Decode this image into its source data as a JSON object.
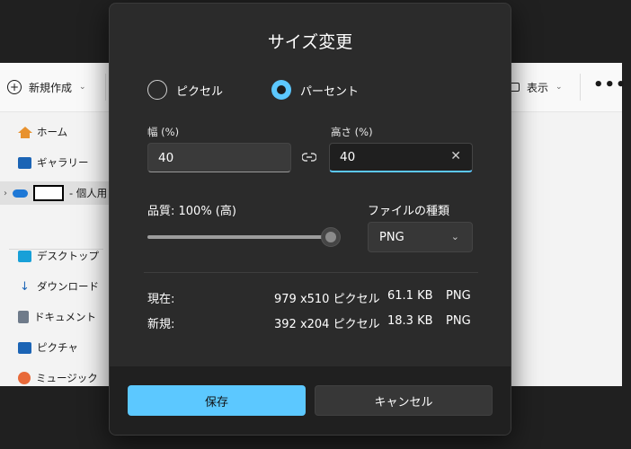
{
  "explorer": {
    "new_label": "新規作成",
    "view_label": "表示",
    "more_label": "•••",
    "sidebar": {
      "items": [
        {
          "label": "ホーム",
          "icon": "home-icon"
        },
        {
          "label": "ギャラリー",
          "icon": "gallery-icon"
        },
        {
          "label": "- 個人用",
          "icon": "onedrive-icon"
        },
        {
          "label": "デスクトップ",
          "icon": "desktop-icon"
        },
        {
          "label": "ダウンロード",
          "icon": "download-icon"
        },
        {
          "label": "ドキュメント",
          "icon": "documents-icon"
        },
        {
          "label": "ピクチャ",
          "icon": "pictures-icon"
        },
        {
          "label": "ミュージック",
          "icon": "music-icon"
        }
      ]
    }
  },
  "dialog": {
    "title": "サイズ変更",
    "mode": {
      "pixel_label": "ピクセル",
      "percent_label": "パーセント",
      "selected": "percent"
    },
    "width": {
      "label": "幅 (%)",
      "value": "40"
    },
    "height": {
      "label": "高さ (%)",
      "value": "40"
    },
    "aspect_lock_icon": "link-icon",
    "quality": {
      "label": "品質: 100% (高)",
      "value_percent": 100
    },
    "file_type": {
      "label": "ファイルの種類",
      "selected": "PNG"
    },
    "current": {
      "label": "現在:",
      "dimensions": "979 x510 ピクセル",
      "size": "61.1 KB",
      "format": "PNG"
    },
    "new": {
      "label": "新規:",
      "dimensions": "392 x204 ピクセル",
      "size": "18.3 KB",
      "format": "PNG"
    },
    "save_label": "保存",
    "cancel_label": "キャンセル"
  },
  "colors": {
    "accent": "#5cc8ff",
    "dialog_bg": "#2b2b2b",
    "footer_bg": "#202020"
  }
}
